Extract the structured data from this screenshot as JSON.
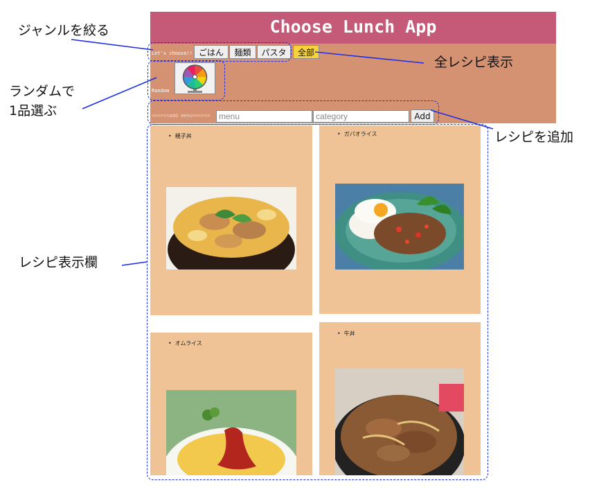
{
  "app": {
    "title": "Choose Lunch App",
    "lets_choose_label": "Let's choose!!",
    "filter_buttons": [
      "ごはん",
      "麺類",
      "パスタ",
      "全部"
    ],
    "active_filter": "全部",
    "random_label": "Random",
    "add_menu_label": "<=<=<=add menu<=<=<=",
    "menu_placeholder": "menu",
    "category_placeholder": "category",
    "add_button": "Add"
  },
  "recipes": [
    {
      "name": "親子丼",
      "image": "oyakodon-photo"
    },
    {
      "name": "ガパオライス",
      "image": "gapao-rice-photo"
    },
    {
      "name": "オムライス",
      "image": "omurice-photo"
    },
    {
      "name": "牛丼",
      "image": "gyudon-photo"
    }
  ],
  "annotations": {
    "filter": "ジャンルを絞る",
    "show_all": "全レシピ表示",
    "random_line1": "ランダムで",
    "random_line2": "1品選ぶ",
    "add_recipe": "レシピを追加",
    "display_area": "レシピ表示欄"
  },
  "colors": {
    "header": "#c55a78",
    "panel": "#d49272",
    "card": "#f0c396",
    "active_button": "#f7d23a",
    "annotation_line": "#1c2ee6"
  }
}
